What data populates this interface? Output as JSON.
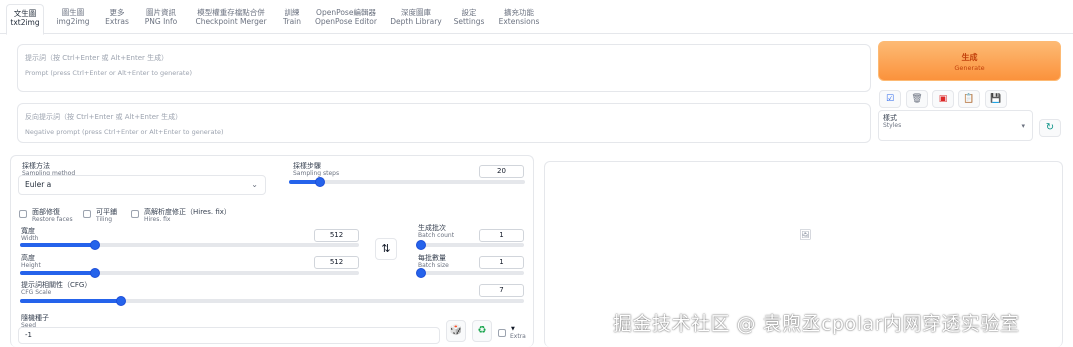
{
  "tabs": [
    {
      "zh": "文生圖",
      "en": "txt2img",
      "active": true
    },
    {
      "zh": "圖生圖",
      "en": "img2img"
    },
    {
      "zh": "更多",
      "en": "Extras"
    },
    {
      "zh": "圖片資訊",
      "en": "PNG Info"
    },
    {
      "zh": "模型權重存檔點合併",
      "en": "Checkpoint Merger"
    },
    {
      "zh": "訓練",
      "en": "Train"
    },
    {
      "zh": "OpenPose編輯器",
      "en": "OpenPose Editor"
    },
    {
      "zh": "深度圖庫",
      "en": "Depth Library"
    },
    {
      "zh": "設定",
      "en": "Settings"
    },
    {
      "zh": "擴充功能",
      "en": "Extensions"
    }
  ],
  "prompt": {
    "placeholder_zh": "提示詞（按 Ctrl+Enter 或 Alt+Enter 生成）",
    "placeholder_en": "Prompt (press Ctrl+Enter or Alt+Enter to generate)"
  },
  "negative_prompt": {
    "placeholder_zh": "反向提示詞（按 Ctrl+Enter 或 Alt+Enter 生成）",
    "placeholder_en": "Negative prompt (press Ctrl+Enter or Alt+Enter to generate)"
  },
  "generate": {
    "zh": "生成",
    "en": "Generate"
  },
  "tools": [
    {
      "icon": "check-icon",
      "glyph": "☑"
    },
    {
      "icon": "trash-icon",
      "glyph": "🗑"
    },
    {
      "icon": "red-card-icon",
      "glyph": "▣"
    },
    {
      "icon": "clipboard-icon",
      "glyph": "📋"
    },
    {
      "icon": "save-icon",
      "glyph": "💾"
    }
  ],
  "styles": {
    "zh": "樣式",
    "en": "Styles",
    "refresh_glyph": "↻"
  },
  "sampling_method": {
    "zh": "採樣方法",
    "en": "Sampling method",
    "value": "Euler a"
  },
  "sampling_steps": {
    "zh": "採樣步驟",
    "en": "Sampling steps",
    "value": "20",
    "fraction": 0.13
  },
  "checkboxes": {
    "restore_faces": {
      "zh": "面部修復",
      "en": "Restore faces"
    },
    "tiling": {
      "zh": "可平鋪",
      "en": "Tiling"
    },
    "hires_fix": {
      "zh": "高解析度修正（Hires. fix）",
      "en": "Hires. fix"
    }
  },
  "width": {
    "zh": "寬度",
    "en": "Width",
    "value": "512",
    "fraction": 0.22
  },
  "height": {
    "zh": "高度",
    "en": "Height",
    "value": "512",
    "fraction": 0.22
  },
  "swap_glyph": "⇅",
  "batch_count": {
    "zh": "生成批次",
    "en": "Batch count",
    "value": "1",
    "fraction": 0.0
  },
  "batch_size": {
    "zh": "每批數量",
    "en": "Batch size",
    "value": "1",
    "fraction": 0.0
  },
  "cfg_scale": {
    "zh": "提示詞相關性（CFG）",
    "en": "CFG Scale",
    "value": "7",
    "fraction": 0.2
  },
  "seed": {
    "zh": "隨機種子",
    "en": "Seed",
    "value": "-1",
    "dice_glyph": "🎲",
    "recycle_glyph": "♻"
  },
  "extra": {
    "glyph": "▼",
    "label": "Extra"
  },
  "output": {
    "icon_glyph": "🖼"
  },
  "watermark": "掘金技术社区 @ 袁煦丞cpolar内网穿透实验室",
  "colors": {
    "accent": "#2563eb",
    "generate": "#fb923c"
  }
}
